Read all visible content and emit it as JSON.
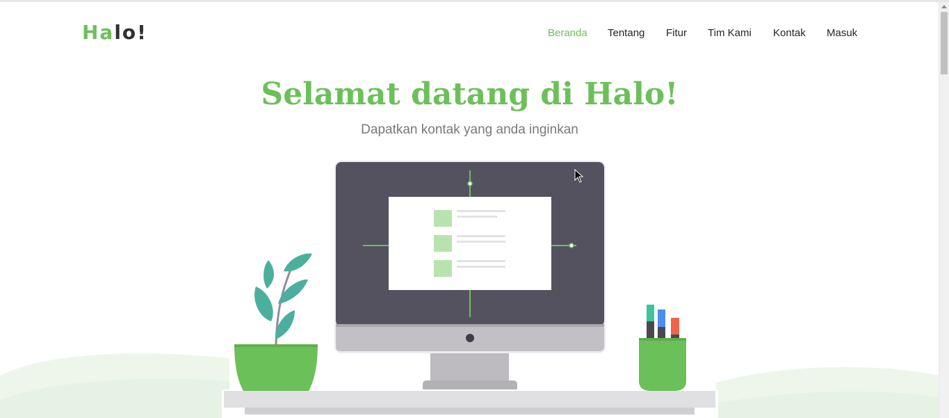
{
  "logo": {
    "part1": "Ha",
    "part2": "lo!"
  },
  "nav": {
    "items": [
      {
        "label": "Beranda",
        "active": true
      },
      {
        "label": "Tentang",
        "active": false
      },
      {
        "label": "Fitur",
        "active": false
      },
      {
        "label": "Tim Kami",
        "active": false
      },
      {
        "label": "Kontak",
        "active": false
      },
      {
        "label": "Masuk",
        "active": false
      }
    ]
  },
  "hero": {
    "title": "Selamat datang di Halo!",
    "subtitle": "Dapatkan kontak yang anda inginkan"
  },
  "colors": {
    "accent": "#6cc05a",
    "text_dark": "#1f2327",
    "subtitle": "#76797c",
    "monitor": "#55525f",
    "leaf": "#4caf9d"
  },
  "icons": [
    "mouse-cursor-icon",
    "plant-pot-icon",
    "pen-holder-icon",
    "monitor-icon"
  ]
}
